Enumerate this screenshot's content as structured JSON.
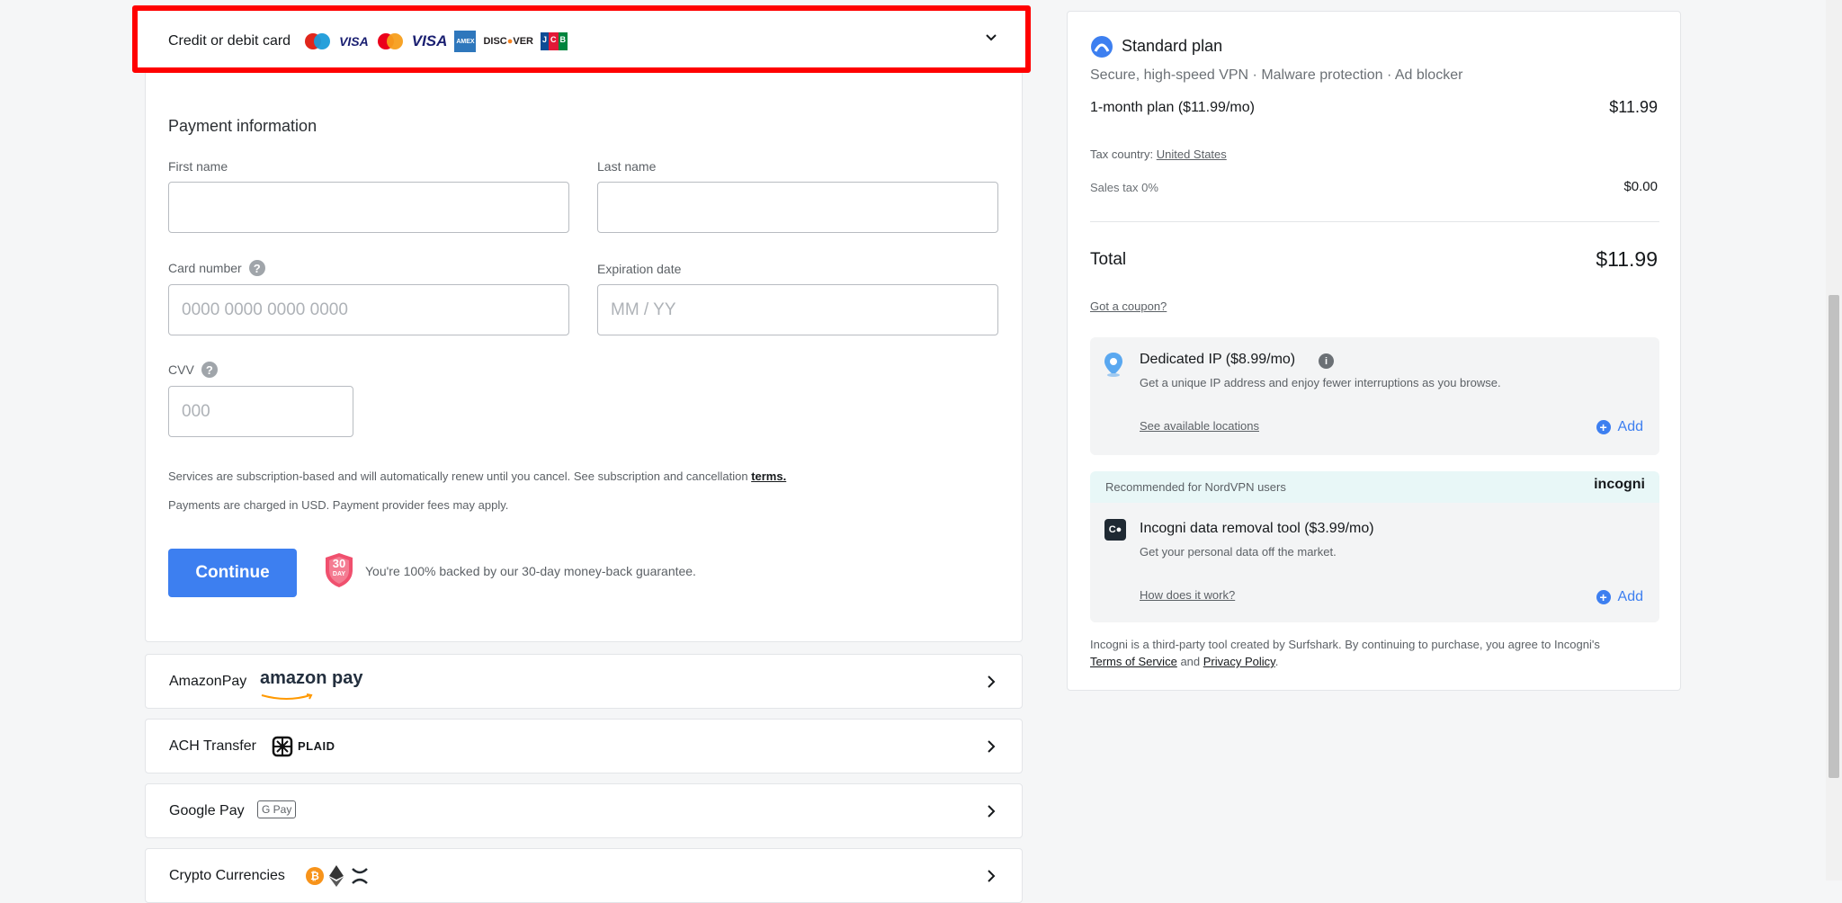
{
  "payment_methods": {
    "card": {
      "label": "Credit or debit card"
    },
    "amazon": {
      "label": "AmazonPay",
      "logo_text": "amazon pay"
    },
    "ach": {
      "label": "ACH Transfer",
      "logo_text": "PLAID"
    },
    "google": {
      "label": "Google Pay",
      "logo_text": "G Pay"
    },
    "crypto": {
      "label": "Crypto Currencies"
    }
  },
  "card_logos": [
    "maestro",
    "VISA",
    "mastercard",
    "VISA",
    "AMEX",
    "DISCOVER",
    "JCB"
  ],
  "form": {
    "heading": "Payment information",
    "first_name": {
      "label": "First name",
      "value": ""
    },
    "last_name": {
      "label": "Last name",
      "value": ""
    },
    "card_number": {
      "label": "Card number",
      "placeholder": "0000 0000 0000 0000"
    },
    "expiration": {
      "label": "Expiration date",
      "placeholder": "MM / YY"
    },
    "cvv": {
      "label": "CVV",
      "placeholder": "000"
    },
    "terms_text": "Services are subscription-based and will automatically renew until you cancel. See subscription and cancellation ",
    "terms_link": "terms.",
    "fees_text": "Payments are charged in USD. Payment provider fees may apply.",
    "continue_label": "Continue",
    "guarantee_badge_top": "30",
    "guarantee_badge_bottom": "DAY",
    "guarantee_text": "You're 100% backed by our 30-day money-back guarantee."
  },
  "summary": {
    "plan_name": "Standard plan",
    "plan_features": "Secure, high-speed VPN · Malware protection · Ad blocker",
    "plan_period": "1-month plan ($11.99/mo)",
    "plan_price": "$11.99",
    "tax_country_label": "Tax country:",
    "tax_country_value": "United States",
    "sales_tax_label": "Sales tax 0%",
    "sales_tax_value": "$0.00",
    "total_label": "Total",
    "total_value": "$11.99",
    "coupon_link": "Got a coupon?"
  },
  "addons": {
    "dedicated_ip": {
      "title": "Dedicated IP ($8.99/mo)",
      "desc": "Get a unique IP address and enjoy fewer interruptions as you browse.",
      "link": "See available locations",
      "add_label": "Add"
    },
    "incogni": {
      "banner": "Recommended for NordVPN users",
      "brand": "incogni",
      "title": "Incogni data removal tool ($3.99/mo)",
      "desc": "Get your personal data off the market.",
      "link": "How does it work?",
      "add_label": "Add",
      "disclaimer": "Incogni is a third-party tool created by Surfshark. By continuing to purchase, you agree to Incogni's",
      "tos_link": "Terms of Service",
      "and_text": "and",
      "privacy_link": "Privacy Policy",
      "period": "."
    }
  }
}
